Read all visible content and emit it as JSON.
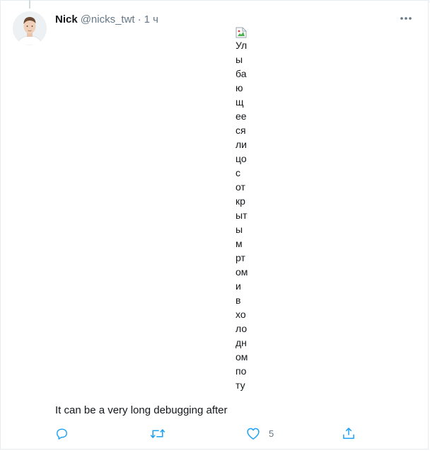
{
  "tweet": {
    "author_name": "Nick",
    "author_handle": "@nicks_twt",
    "separator": "·",
    "time": "1 ч",
    "text": "It can be a very long debugging after",
    "image_alt": "Улыбающееся лицо с открытым ртом и в холодном поту"
  },
  "actions": {
    "like_count": "5"
  },
  "icons": {
    "reply": "reply-icon",
    "retweet": "retweet-icon",
    "like": "heart-icon",
    "share": "share-icon",
    "more": "more-icon",
    "broken_image": "broken-image-icon"
  },
  "colors": {
    "text": "#14171a",
    "secondary": "#657786",
    "icon": "#1da1f2",
    "border": "#e6ecf0"
  }
}
